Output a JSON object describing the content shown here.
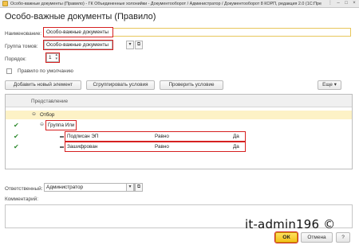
{
  "window": {
    "title": "Особо-важные документы (Правило) - ГК Объединенные холонийки - Документооборот / Администратор / Документооборот 8 КОРП, редакция 2.0  (1С:Предприятие)"
  },
  "form": {
    "title": "Особо-важные документы (Правило)"
  },
  "fields": {
    "name_label": "Наименование:",
    "name_value": "Особо-важные документы",
    "group_label": "Группа томов:",
    "group_value": "Особо-важные документы",
    "order_label": "Порядок:",
    "order_value": "1",
    "default_label": "Правило по умолчанию"
  },
  "toolbar": {
    "add_element": "Добавить новый элемент",
    "group_conditions": "Сгруппировать условия",
    "check_condition": "Проверить условие",
    "more": "Еще"
  },
  "table": {
    "header": "Представление",
    "rows": [
      {
        "label": "Отбор"
      },
      {
        "label": "Группа Или"
      },
      {
        "label": "Подписан ЭП",
        "condition": "Равно",
        "value": "Да"
      },
      {
        "label": "Зашифрован",
        "condition": "Равно",
        "value": "Да"
      }
    ]
  },
  "responsible": {
    "label": "Ответственный:",
    "value": "Администратор"
  },
  "comment": {
    "label": "Комментарий:"
  },
  "watermark": "it-admin196 ©",
  "buttons": {
    "ok": "ОК",
    "cancel": "Отмена",
    "help": "?"
  },
  "icons": [
    "app-icon",
    "dropdown-icon",
    "open-icon",
    "spinner-icon",
    "checkmark-icon",
    "dash-icon",
    "expander-icon"
  ]
}
